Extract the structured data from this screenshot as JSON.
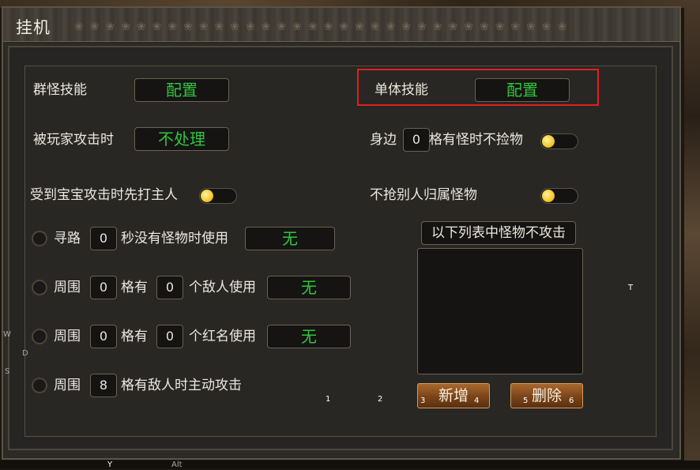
{
  "window": {
    "title": "挂机"
  },
  "group_skill": {
    "label": "群怪技能",
    "value": "配置"
  },
  "single_skill": {
    "label": "单体技能",
    "value": "配置"
  },
  "player_attack": {
    "label": "被玩家攻击时",
    "value": "不处理"
  },
  "nearby_loot": {
    "prefix": "身边",
    "count": "0",
    "suffix": "格有怪时不捡物"
  },
  "pet_attack": {
    "label": "受到宝宝攻击时先打主人"
  },
  "no_steal": {
    "label": "不抢别人归属怪物"
  },
  "pathfind": {
    "label": "寻路",
    "seconds": "0",
    "suffix": "秒没有怪物时使用",
    "value": "无"
  },
  "enemy_row": {
    "label": "周围",
    "cells": "0",
    "mid": "格有",
    "count": "0",
    "suffix": "个敌人使用",
    "value": "无"
  },
  "redname_row": {
    "label": "周围",
    "cells": "0",
    "mid": "格有",
    "count": "0",
    "suffix": "个红名使用",
    "value": "无"
  },
  "auto_attack": {
    "label": "周围",
    "cells": "8",
    "suffix": "格有敌人时主动攻击"
  },
  "monster_list": {
    "header": "以下列表中怪物不攻击"
  },
  "buttons": {
    "add": "新增",
    "delete": "删除"
  },
  "hints": {
    "n1": "1",
    "n2": "2",
    "n3": "3",
    "n4": "4",
    "n5": "5",
    "n6": "6",
    "t": "T",
    "w": "W",
    "d": "D",
    "s": "S",
    "y": "Y",
    "alt": "Alt"
  },
  "colors": {
    "accent_green": "#2fc63a",
    "highlight_red": "#e02020",
    "toggle_knob": "#f4c628"
  }
}
